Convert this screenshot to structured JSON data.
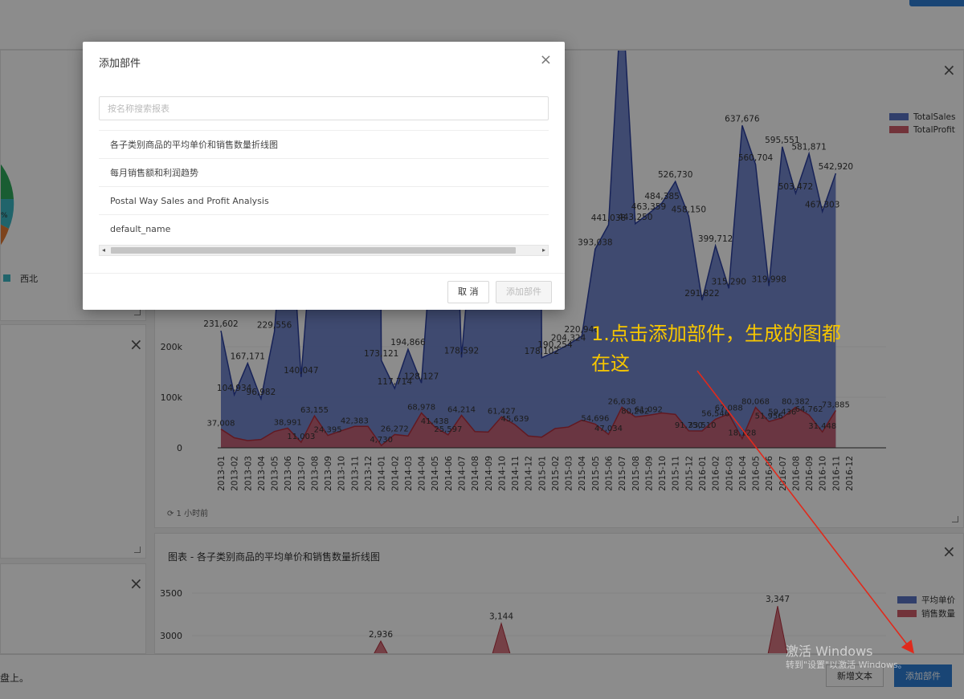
{
  "dialog": {
    "title": "添加部件",
    "close_label": "×",
    "search_placeholder": "按名称搜索报表",
    "items": [
      "各子类别商品的平均单价和销售数量折线图",
      "每月销售额和利润趋势",
      "Postal Way Sales and Profit Analysis",
      "default_name"
    ],
    "cancel_label": "取 消",
    "add_label": "添加部件"
  },
  "background": {
    "pie_legend_label": "西北",
    "pie_pct_fragment": "%",
    "close_label": "×",
    "refresh_text": "⟳ 1 小时前",
    "chart2_title": "图表 - 各子类别商品的平均单价和销售数量折线图",
    "bottom_hint": "盘上。",
    "new_text_button": "新增文本",
    "add_widget_button": "添加部件"
  },
  "annotation": {
    "line1": "1.点击添加部件，生成的图都",
    "line2": "在这"
  },
  "watermark": {
    "line1": "激活 Windows",
    "line2": "转到\"设置\"以激活 Windows。"
  },
  "colors": {
    "sales": "#5a73c4",
    "profit": "#cf5d6a",
    "accent": "#2f7fd6",
    "annotation": "#f7c600"
  },
  "chart_data": [
    {
      "type": "area",
      "x": [
        "2013-01",
        "2013-02",
        "2013-03",
        "2013-04",
        "2013-05",
        "2013-06",
        "2013-07",
        "2013-08",
        "2013-09",
        "2013-10",
        "2013-11",
        "2013-12",
        "2014-01",
        "2014-02",
        "2014-03",
        "2014-04",
        "2014-05",
        "2014-06",
        "2014-07",
        "2014-08",
        "2014-09",
        "2014-10",
        "2014-11",
        "2014-12",
        "2015-01",
        "2015-02",
        "2015-03",
        "2015-04",
        "2015-05",
        "2015-06",
        "2015-07",
        "2015-08",
        "2015-09",
        "2015-10",
        "2015-11",
        "2015-12",
        "2016-01",
        "2016-02",
        "2016-03",
        "2016-04",
        "2016-05",
        "2016-06",
        "2016-07",
        "2016-08",
        "2016-09",
        "2016-10",
        "2016-11",
        "2016-12"
      ],
      "y_ticks": [
        "0",
        "100k",
        "200k"
      ],
      "ylim": [
        0,
        680000
      ],
      "legend": "top-right",
      "series": [
        {
          "name": "TotalSales",
          "values": [
            231602,
            104934,
            167171,
            96982,
            229556,
            null,
            140047,
            null,
            null,
            null,
            null,
            null,
            173121,
            117714,
            194866,
            128127,
            null,
            null,
            178592,
            null,
            null,
            null,
            null,
            null,
            178102,
            190254,
            204324,
            220946,
            393038,
            441038,
            null,
            443250,
            463359,
            484385,
            526730,
            458150,
            291822,
            399712,
            315290,
            637676,
            560704,
            319998,
            595551,
            503472,
            581871,
            467303,
            542920,
            null
          ],
          "labels": {
            "0": "231,602",
            "1": "104,934",
            "2": "167,171",
            "3": "96,982",
            "4": "229,556",
            "6": "140,047",
            "12": "173,121",
            "13": "117,714",
            "14": "194,866",
            "15": "128,127",
            "18": "178,592",
            "24": "178,102",
            "25": "190,254",
            "26": "204,324",
            "27": "220,946",
            "28": "393,038",
            "29": "441,038",
            "31": "443,250",
            "32": "463,359",
            "33": "484,385",
            "34": "526,730",
            "35": "458,150",
            "36": "291,822",
            "37": "399,712",
            "38": "315,290",
            "39": "637,676",
            "40": "560,704",
            "41": "319,998",
            "42": "595,551",
            "43": "503,472",
            "44": "581,871",
            "45": "467,303",
            "46": "542,920"
          }
        },
        {
          "name": "TotalProfit",
          "values": [
            37008,
            19857,
            14243,
            16463,
            32304,
            38991,
            11003,
            63155,
            24395,
            33695,
            42383,
            42367,
            4730,
            26272,
            23424,
            68978,
            41438,
            25597,
            64214,
            32128,
            31195,
            61427,
            45639,
            23328,
            21123,
            38113,
            41174,
            54696,
            47034,
            26638,
            80262,
            61092,
            64404,
            68919,
            66039,
            33510,
            33420,
            56546,
            67088,
            18128,
            80068,
            51956,
            59436,
            80382,
            64762,
            31448,
            73885,
            null
          ],
          "labels": {
            "0": "37,008",
            "5": "38,991",
            "6": "11,003",
            "7": "63,155",
            "8": "24,395",
            "10": "42,383",
            "12": "4,730",
            "13": "26,272",
            "15": "68,978",
            "16": "41,438",
            "17": "25,597",
            "18": "64,214",
            "21": "61,427",
            "22": "45,639",
            "28": "54,696",
            "29": "47,034",
            "30": "26,638",
            "31": "80,262",
            "32": "61,092",
            "36": "33,510",
            "37": "56,546",
            "38": "67,088",
            "39": "18,128",
            "40": "80,068",
            "41": "51,956",
            "42": "59,436",
            "43": "80,382",
            "44": "64,762",
            "45": "31,448",
            "46": "73,885",
            "35": "91,750"
          }
        }
      ]
    },
    {
      "type": "area",
      "title": "图表 - 各子类别商品的平均单价和销售数量折线图",
      "y_ticks": [
        "3000",
        "3500"
      ],
      "legend": "top-right",
      "series": [
        {
          "name": "平均单价"
        },
        {
          "name": "销售数量",
          "peaks": [
            {
              "label": "2,936",
              "value": 2936
            },
            {
              "label": "3,144",
              "value": 3144
            },
            {
              "label": "3,347",
              "value": 3347
            }
          ]
        }
      ]
    }
  ]
}
